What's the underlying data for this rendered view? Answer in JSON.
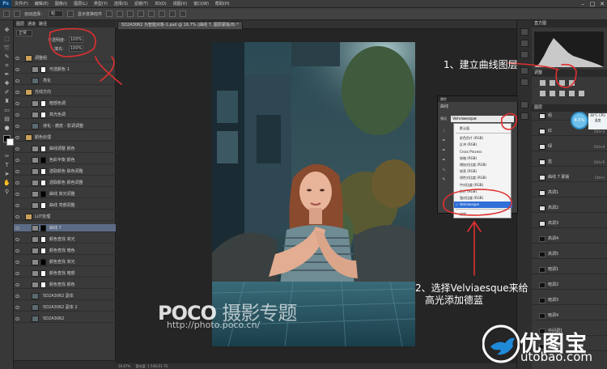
{
  "app": {
    "logo": "Ps"
  },
  "menubar": {
    "items": [
      "文件(F)",
      "编辑(E)",
      "图像(I)",
      "图层(L)",
      "类型(Y)",
      "选择(S)",
      "滤镜(T)",
      "3D(D)",
      "视图(V)",
      "窗口(W)",
      "帮助(H)"
    ]
  },
  "window_controls": {
    "minimize": "–",
    "maximize": "□",
    "close": "✕"
  },
  "optionsbar": {
    "auto_select_label": "自动选择：",
    "auto_select_value": "组",
    "transform_label": "显示变换控件"
  },
  "document_tab": {
    "label": "5D2A3062 为智能对象-1.psd @ 16.7% (曲线 7, 图层蒙版/8) *"
  },
  "layers_panel": {
    "tabs": [
      "图层",
      "通道",
      "路径"
    ],
    "blend_mode": "正常",
    "opacity_label": "不透明度:",
    "opacity_value": "100%",
    "fill_label": "填充:",
    "fill_value": "100%",
    "rows": [
      {
        "name": "调整组",
        "type": "group"
      },
      {
        "name": "可选颜色 1",
        "type": "adj"
      },
      {
        "name": "亮化",
        "type": "layer"
      },
      {
        "name": "光线方向",
        "type": "group"
      },
      {
        "name": "暗部色调",
        "type": "adj"
      },
      {
        "name": "高光色调",
        "type": "adj"
      },
      {
        "name": "液化 - 磨皮 - 影调调整",
        "type": "layer"
      },
      {
        "name": "颜色处理",
        "type": "group"
      },
      {
        "name": "曲线调整 颜色",
        "type": "adj"
      },
      {
        "name": "色彩平衡 颜色",
        "type": "adj"
      },
      {
        "name": "选取颜色 肤色调整",
        "type": "adj"
      },
      {
        "name": "选取颜色 颜色调整",
        "type": "adj"
      },
      {
        "name": "曲线 高光调整",
        "type": "adj"
      },
      {
        "name": "曲线 亮部调整",
        "type": "adj"
      },
      {
        "name": "LUT处理",
        "type": "group"
      },
      {
        "name": "曲线 7",
        "type": "adj",
        "selected": true
      },
      {
        "name": "颜色查找 高光",
        "type": "adj"
      },
      {
        "name": "颜色查找 暗色",
        "type": "adj"
      },
      {
        "name": "颜色查找 高光",
        "type": "adj"
      },
      {
        "name": "颜色查找 暗部",
        "type": "adj"
      },
      {
        "name": "颜色查找 颜色",
        "type": "adj"
      },
      {
        "name": "5D2A3062 副本",
        "type": "layer"
      },
      {
        "name": "5D2A3062 副本 2",
        "type": "layer"
      },
      {
        "name": "5D2A3062",
        "type": "layer"
      }
    ]
  },
  "properties_panel": {
    "header": "属性",
    "subtitle": "曲线",
    "preset_label": "预设",
    "preset_value": "Velviaesque",
    "presets": [
      {
        "label": "默认值"
      },
      {
        "label": "彩色负片 (RGB)"
      },
      {
        "label": "反冲 (RGB)"
      },
      {
        "label": "Cross Process"
      },
      {
        "label": "较暗 (RGB)"
      },
      {
        "label": "增加对比度 (RGB)"
      },
      {
        "label": "较亮 (RGB)"
      },
      {
        "label": "线性对比度 (RGB)"
      },
      {
        "label": "中对比度 (RGB)"
      },
      {
        "label": "负片 (RGB)"
      },
      {
        "label": "强对比度 (RGB)"
      },
      {
        "label": "Velviaesque",
        "selected": true
      },
      {
        "label": "自定"
      }
    ]
  },
  "right_panel": {
    "histogram_title": "直方图",
    "adjust_title": "调整",
    "layers_title": "图层",
    "rows": [
      {
        "name": "组",
        "shortcut": "Ctrl+3",
        "dark": false
      },
      {
        "name": "红",
        "shortcut": "Ctrl+3",
        "dark": false
      },
      {
        "name": "绿",
        "shortcut": "Ctrl+4",
        "dark": false
      },
      {
        "name": "蓝",
        "shortcut": "Ctrl+5",
        "dark": false
      },
      {
        "name": "曲线 7 蒙版",
        "shortcut": "Ctrl+\\",
        "dark": false
      },
      {
        "name": "高调1",
        "shortcut": "",
        "dark": false
      },
      {
        "name": "高调2",
        "shortcut": "",
        "dark": false
      },
      {
        "name": "高调3",
        "shortcut": "",
        "dark": false
      },
      {
        "name": "高调4",
        "shortcut": "",
        "dark": true
      },
      {
        "name": "高调5",
        "shortcut": "",
        "dark": true
      },
      {
        "name": "暗调1",
        "shortcut": "",
        "dark": true
      },
      {
        "name": "暗调2",
        "shortcut": "",
        "dark": true
      },
      {
        "name": "暗调3",
        "shortcut": "",
        "dark": true
      },
      {
        "name": "暗调4",
        "shortcut": "",
        "dark": true
      },
      {
        "name": "中间调1",
        "shortcut": "",
        "dark": true
      },
      {
        "name": "中间调2",
        "shortcut": "",
        "dark": true
      }
    ],
    "cpu_badge": "4.5%",
    "cpu_info": "38°C CPU温度"
  },
  "statusbar": {
    "zoom": "16.67%",
    "doc_info": "暂存盘: 1.54G/21.7G"
  },
  "annotations": {
    "step1": "1、建立曲线图层",
    "step2_line1": "2、选择Velviaesque来给",
    "step2_line2": "高光添加德蓝"
  },
  "watermark": {
    "brand": "POCO",
    "brand2": "摄影专题",
    "url": "http://photo.poco.cn/"
  },
  "site_logo": {
    "cn": "优图宝",
    "en": "utobao.com"
  },
  "colors": {
    "annotation_red": "#e03030",
    "selection_blue": "#2f6fd8",
    "utobao_blue": "#1f8ad8"
  }
}
